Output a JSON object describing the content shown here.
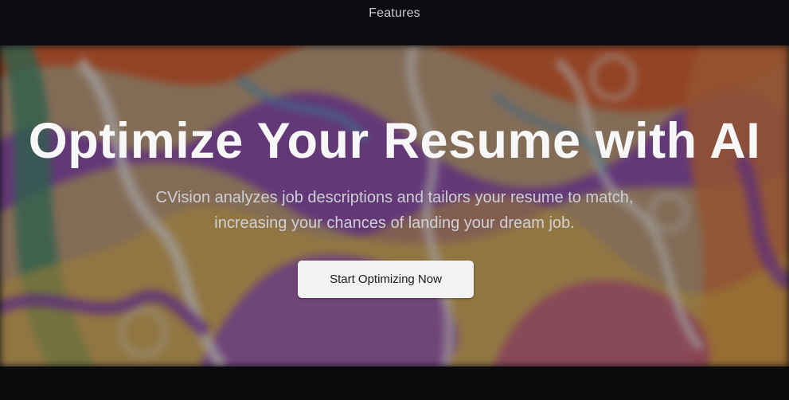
{
  "nav": {
    "features_label": "Features"
  },
  "hero": {
    "title": "Optimize Your Resume with AI",
    "subtitle_line1": "CVision analyzes job descriptions and tailors your resume to match,",
    "subtitle_line2": "increasing your chances of landing your dream job.",
    "cta_label": "Start Optimizing Now",
    "background_colors": [
      "#8a3fb8",
      "#e0602a",
      "#f0c040",
      "#3f8f6a",
      "#f5f0e8",
      "#c94a8c",
      "#5aa0c8"
    ]
  }
}
